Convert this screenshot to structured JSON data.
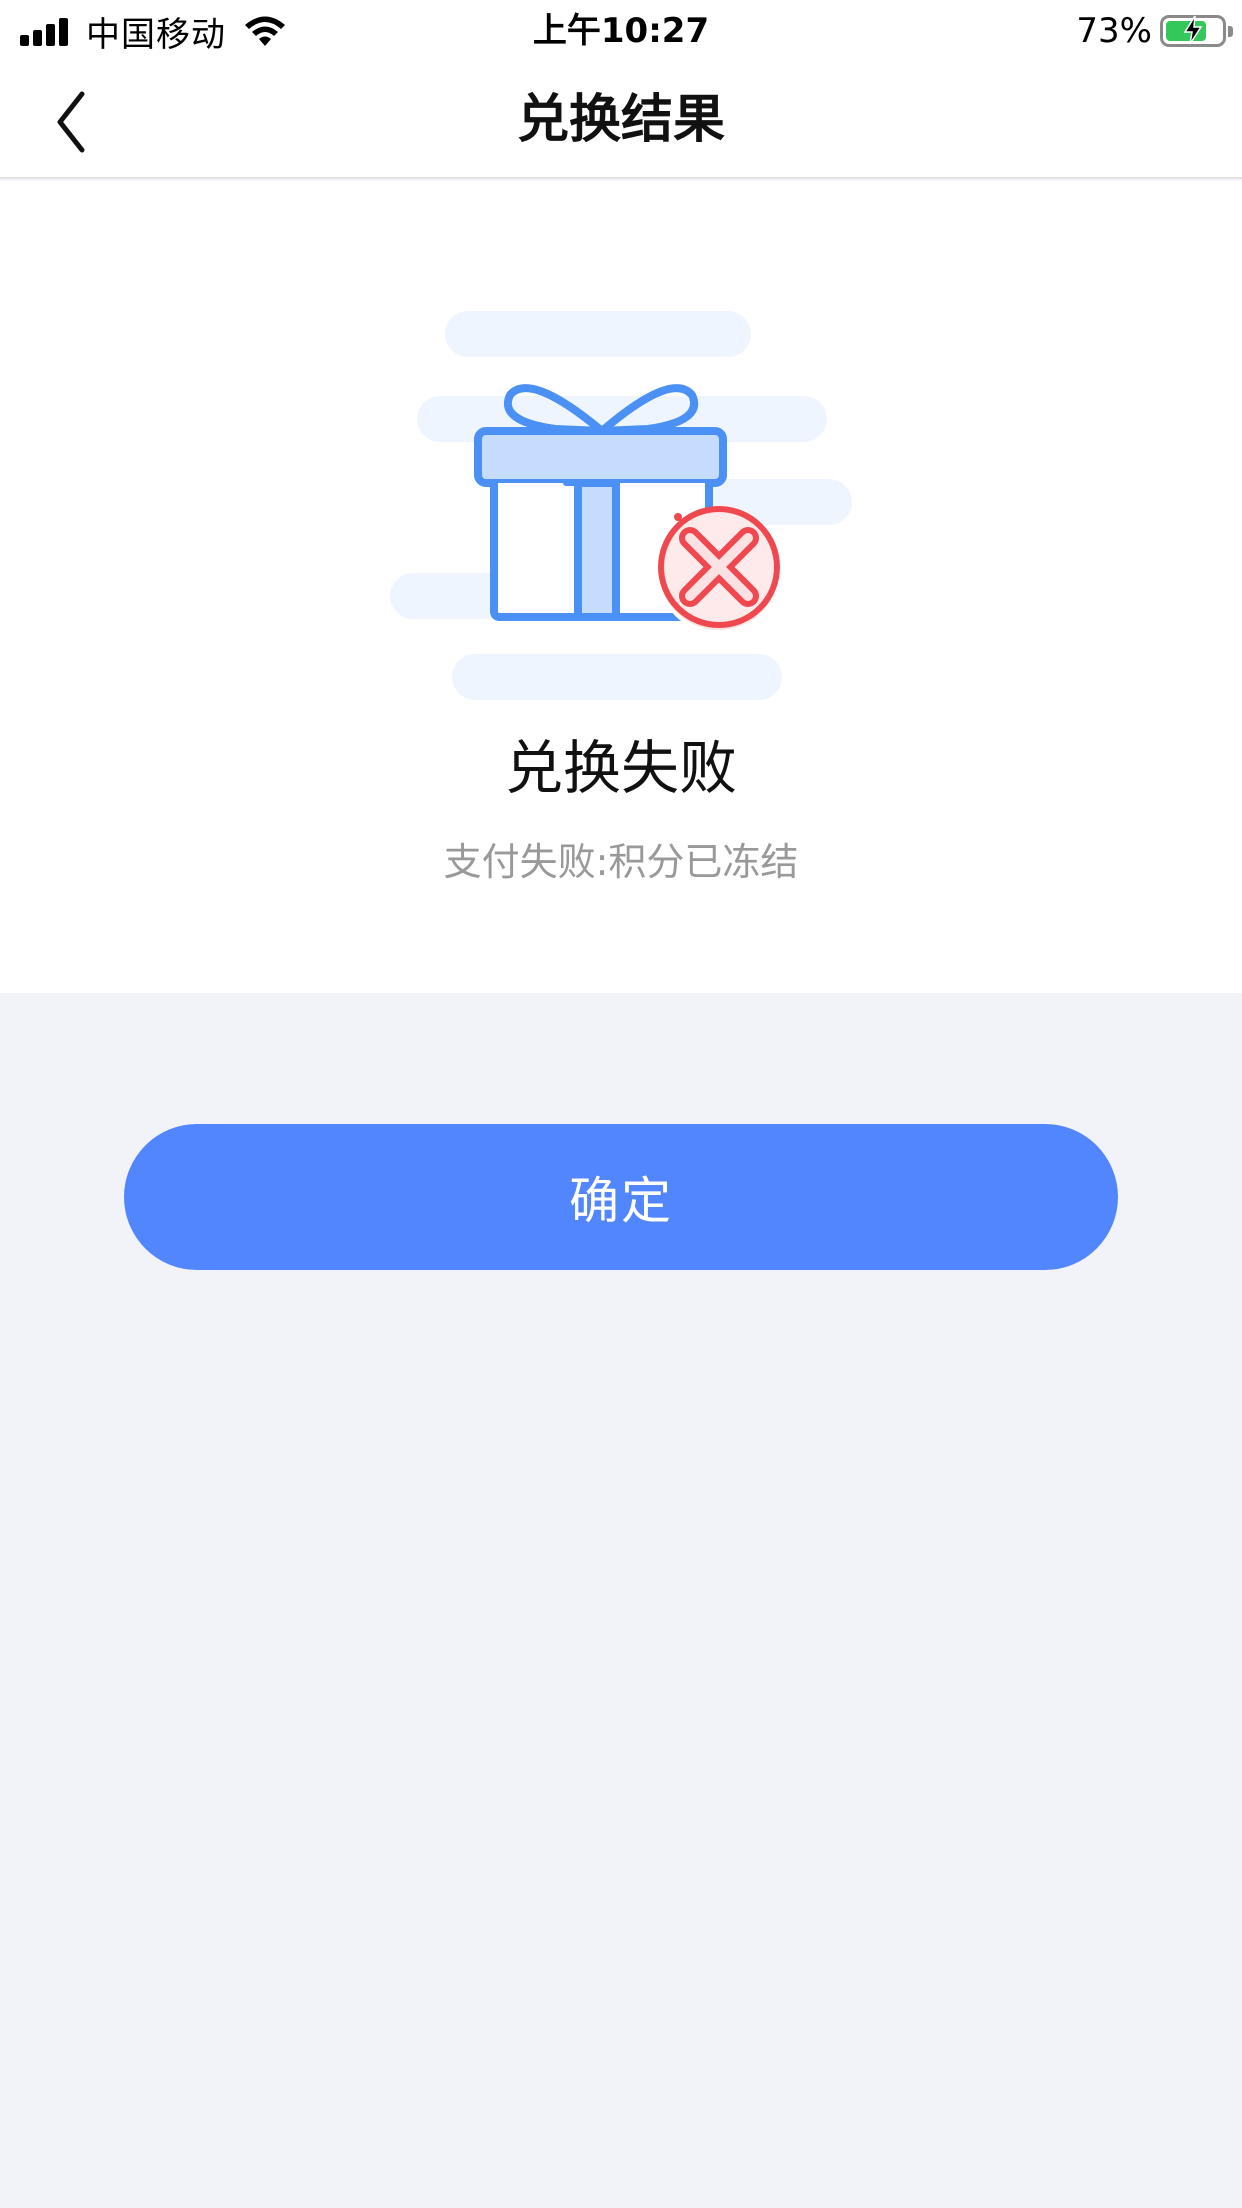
{
  "status_bar": {
    "carrier": "中国移动",
    "time": "上午10:27",
    "battery_percent": "73%",
    "icons": [
      "signal-icon",
      "wifi-icon",
      "battery-icon"
    ]
  },
  "nav": {
    "title": "兑换结果",
    "back_icon": "chevron-left-icon"
  },
  "result": {
    "illustration_icon": "gift-box-failed-icon",
    "title": "兑换失败",
    "message": "支付失败:积分已冻结"
  },
  "actions": {
    "confirm_label": "确定"
  },
  "colors": {
    "primary": "#5286ff",
    "error": "#f0484f",
    "gift_blue": "#4a90f5",
    "page_background": "#f2f3f8"
  }
}
